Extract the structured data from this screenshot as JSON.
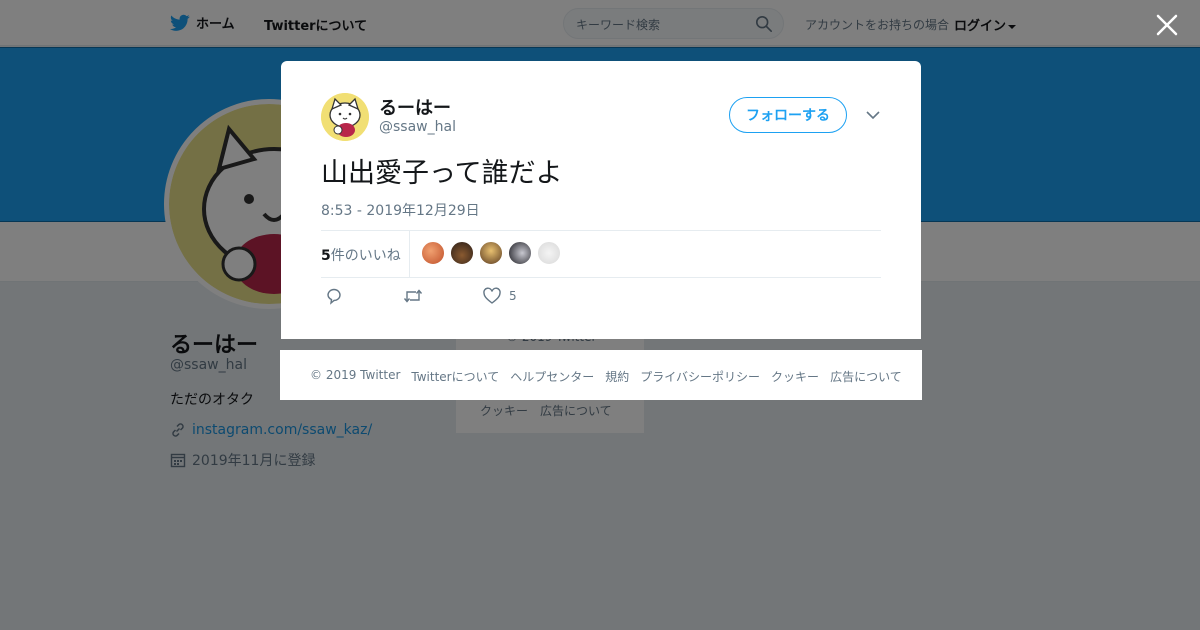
{
  "nav": {
    "home_label": "ホーム",
    "about_label": "Twitterについて",
    "search_placeholder": "キーワード検索",
    "login_prompt": "アカウントをお持ちの場合",
    "login_label": "ログイン"
  },
  "profile": {
    "name": "るーはー",
    "handle": "@ssaw_hal",
    "bio": "ただのオタク",
    "link": "instagram.com/ssaw_kaz/",
    "joined": "2019年11月に登録"
  },
  "side_footer": {
    "copyright": "© 2019 Twitter",
    "links": [
      "クッキー",
      "広告について"
    ]
  },
  "modal": {
    "user_name": "るーはー",
    "user_handle": "@ssaw_hal",
    "follow_label": "フォローする",
    "tweet_text": "山出愛子って誰だよ",
    "timestamp": "8:53 - 2019年12月29日",
    "likes_count": "5",
    "likes_label": "件のいいね",
    "like_action_count": "5"
  },
  "footer": {
    "copyright": "© 2019 Twitter",
    "about": "Twitterについて",
    "help": "ヘルプセンター",
    "terms": "規約",
    "privacy": "プライバシーポリシー",
    "cookies": "クッキー",
    "ads": "広告について"
  },
  "colors": {
    "brand": "#1da1f2",
    "link": "#1b95e0",
    "muted": "#657786",
    "text": "#14171a"
  },
  "icons": [
    "twitter-bird-icon",
    "search-icon",
    "close-icon",
    "chevron-down-icon",
    "link-icon",
    "calendar-icon",
    "reply-icon",
    "retweet-icon",
    "heart-icon"
  ]
}
